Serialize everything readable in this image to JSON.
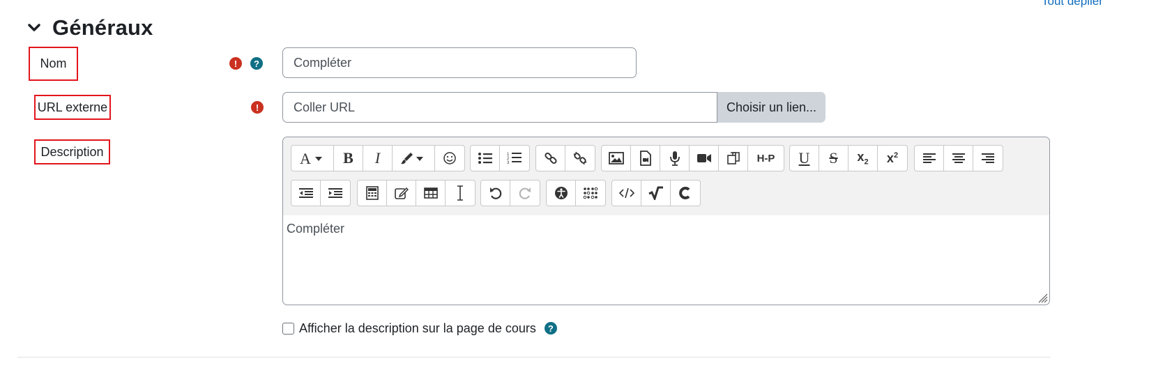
{
  "header": {
    "expand_all": "Tout déplier",
    "section_title": "Généraux"
  },
  "fields": {
    "name": {
      "label": "Nom",
      "placeholder": "Compléter"
    },
    "url": {
      "label": "URL externe",
      "placeholder": "Coller URL",
      "choose_button": "Choisir un lien..."
    },
    "description": {
      "label": "Description",
      "content": "Compléter"
    }
  },
  "toolbar": {
    "row1": [
      [
        "font-size-icon",
        "bold-icon",
        "italic-icon",
        "paintbrush-icon",
        "emoji-icon"
      ],
      [
        "bulleted-list-icon",
        "numbered-list-icon"
      ],
      [
        "link-icon",
        "unlink-icon"
      ],
      [
        "image-icon",
        "media-icon",
        "microphone-icon",
        "video-camera-icon",
        "copy-icon",
        "h5p-icon"
      ],
      [
        "underline-icon",
        "strikethrough-icon",
        "subscript-icon",
        "superscript-icon"
      ],
      [
        "align-left-icon",
        "align-center-icon",
        "align-right-icon"
      ]
    ],
    "row2": [
      [
        "outdent-icon",
        "indent-icon"
      ],
      [
        "calculator-icon",
        "edit-icon",
        "table-icon",
        "text-cursor-icon"
      ],
      [
        "undo-icon",
        "redo-icon"
      ],
      [
        "accessibility-icon",
        "braille-icon"
      ],
      [
        "code-icon",
        "square-root-icon",
        "chemistry-icon"
      ]
    ],
    "h5p_text": "H-P"
  },
  "show_description": {
    "label": "Afficher la description sur la page de cours",
    "checked": false
  },
  "colors": {
    "required": "#ca3120",
    "help": "#0f6f85",
    "link": "#0f6cbf",
    "highlight_border": "#e2151c"
  }
}
